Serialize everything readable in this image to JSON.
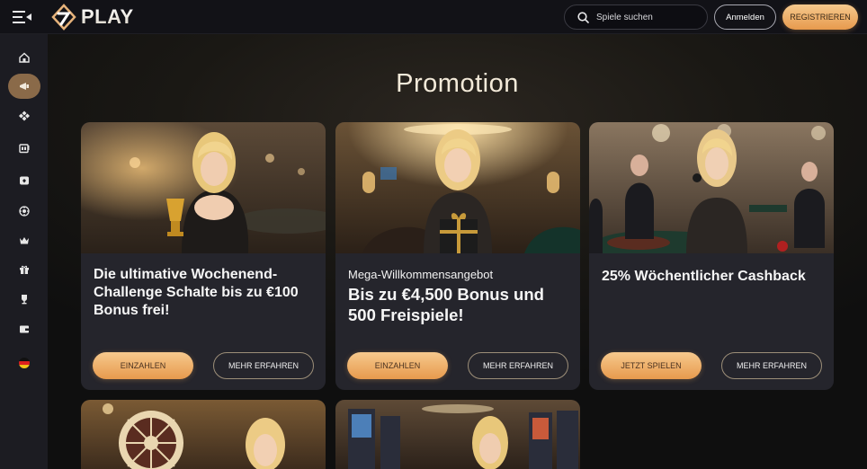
{
  "header": {
    "logo_text": "PLAY",
    "search_placeholder": "Spiele suchen",
    "login_label": "Anmelden",
    "register_label": "REGISTRIEREN"
  },
  "sidebar": {
    "items": [
      {
        "icon": "home-icon",
        "active": false
      },
      {
        "icon": "promotion-icon",
        "active": true
      },
      {
        "icon": "games-icon",
        "active": false
      },
      {
        "icon": "slots-icon",
        "active": false
      },
      {
        "icon": "live-casino-icon",
        "active": false
      },
      {
        "icon": "roulette-icon",
        "active": false
      },
      {
        "icon": "crown-icon",
        "active": false
      },
      {
        "icon": "gift-icon",
        "active": false
      },
      {
        "icon": "trophy-icon",
        "active": false
      },
      {
        "icon": "wallet-icon",
        "active": false
      },
      {
        "icon": "german-flag-icon",
        "active": false
      }
    ]
  },
  "main": {
    "title": "Promotion",
    "cards": [
      {
        "subtitle": "",
        "title": "Die ultimative Wochenend-Challenge Schalte bis zu €100 Bonus frei!",
        "primary_label": "EINZAHLEN",
        "secondary_label": "MEHR ERFAHREN"
      },
      {
        "subtitle": "Mega-Willkommensangebot",
        "title": "Bis zu €4,500 Bonus und 500 Freispiele!",
        "primary_label": "EINZAHLEN",
        "secondary_label": "MEHR ERFAHREN"
      },
      {
        "subtitle": "",
        "title": "25% Wöchentlicher Cashback",
        "primary_label": "JETZT SPIELEN",
        "secondary_label": "MEHR ERFAHREN"
      }
    ]
  },
  "colors": {
    "accent_gold": "#e79a4d",
    "active_side": "#8a6a49",
    "card_bg": "#25252c"
  }
}
